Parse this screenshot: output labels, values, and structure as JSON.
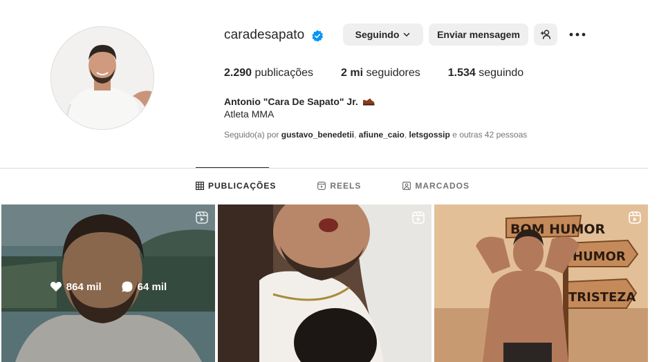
{
  "profile": {
    "username": "caradesapato",
    "verified": true,
    "full_name": "Antonio \"Cara De Sapato\" Jr.",
    "category": "Atleta MMA",
    "stats": {
      "posts_count": "2.290",
      "posts_label": "publicações",
      "followers_count": "2 mi",
      "followers_label": "seguidores",
      "following_count": "1.534",
      "following_label": "seguindo"
    },
    "followed_by": {
      "prefix": "Seguido(a) por",
      "users": [
        "gustavo_benedetii",
        "afiune_caio",
        "letsgossip"
      ],
      "suffix": "e outras 42 pessoas"
    }
  },
  "actions": {
    "following_label": "Seguindo",
    "message_label": "Enviar mensagem",
    "add_user_icon": "add-user-icon",
    "more_icon": "more-options-icon"
  },
  "tabs": [
    {
      "label": "PUBLICAÇÕES",
      "icon": "grid-icon",
      "active": true
    },
    {
      "label": "REELS",
      "icon": "reels-icon",
      "active": false
    },
    {
      "label": "MARCADOS",
      "icon": "tagged-icon",
      "active": false
    }
  ],
  "posts": [
    {
      "type": "reel",
      "likes": "864 mil",
      "comments": "64 mil",
      "hovered": true
    },
    {
      "type": "reel"
    },
    {
      "type": "reel",
      "sign_texts": [
        "BOM HUMOR",
        "HUMOR",
        "TRISTEZA"
      ]
    }
  ],
  "colors": {
    "verified_blue": "#0095f6",
    "button_bg": "#efefef",
    "text_primary": "#262626",
    "text_secondary": "#737373"
  }
}
